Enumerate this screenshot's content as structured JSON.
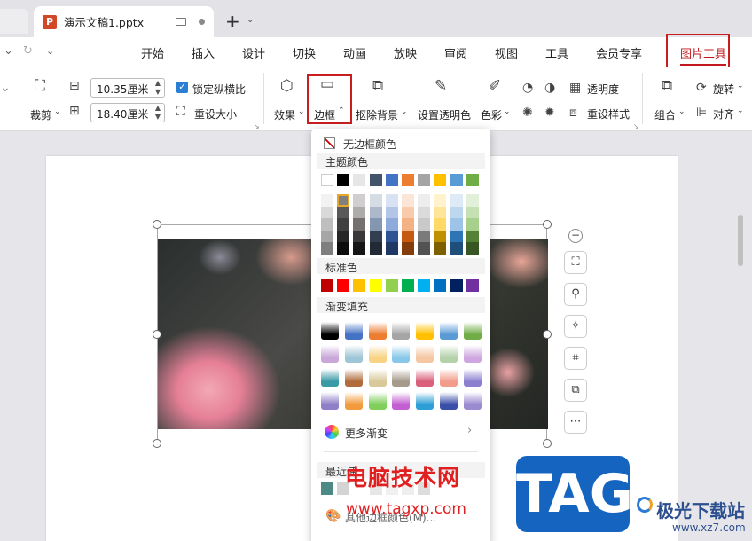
{
  "titlebar": {
    "tab_title": "演示文稿1.pptx",
    "app_icon_letter": "P",
    "new_tab": "+",
    "new_tab_caret": "⌄"
  },
  "menubar": {
    "items": [
      "开始",
      "插入",
      "设计",
      "切换",
      "动画",
      "放映",
      "审阅",
      "视图",
      "工具",
      "会员专享"
    ],
    "active": "图片工具"
  },
  "ribbon": {
    "crop": "裁剪",
    "width": "10.35厘米",
    "height": "18.40厘米",
    "lock_ratio": "锁定纵横比",
    "reset_size": "重设大小",
    "effects": "效果",
    "border": "边框",
    "remove_bg": "抠除背景",
    "set_transparent": "设置透明色",
    "color": "色彩",
    "transparency": "透明度",
    "reset_style": "重设样式",
    "group": "组合",
    "rotate": "旋转",
    "align": "对齐"
  },
  "dropdown": {
    "no_border": "无边框颜色",
    "theme_colors": "主题颜色",
    "standard_colors": "标准色",
    "gradient_fill": "渐变填充",
    "more_gradient": "更多渐变",
    "recent": "最近使",
    "other_colors": "其他边框颜色(M)...",
    "theme_top": [
      "#ffffff",
      "#000000",
      "#e7e6e6",
      "#44546a",
      "#4472c4",
      "#ed7d31",
      "#a5a5a5",
      "#ffc000",
      "#5b9bd5",
      "#70ad47"
    ],
    "theme_shades": [
      [
        "#f2f2f2",
        "#808080",
        "#d0cece",
        "#d6dce4",
        "#d9e2f3",
        "#fbe5d6",
        "#ededed",
        "#fff2cc",
        "#deebf6",
        "#e2efd9"
      ],
      [
        "#d9d9d9",
        "#595959",
        "#aeabab",
        "#adb9ca",
        "#b4c6e7",
        "#f7cbac",
        "#dbdbdb",
        "#ffe598",
        "#bdd7ee",
        "#c5e0b3"
      ],
      [
        "#bfbfbf",
        "#404040",
        "#757070",
        "#8496b0",
        "#8eaadb",
        "#f4b183",
        "#c9c9c9",
        "#ffd966",
        "#9dc3e6",
        "#a8d08d"
      ],
      [
        "#a6a6a6",
        "#262626",
        "#3a3838",
        "#333f50",
        "#2f5496",
        "#c55a11",
        "#7b7b7b",
        "#bf9000",
        "#2e75b5",
        "#538135"
      ],
      [
        "#7f7f7f",
        "#0d0d0d",
        "#171616",
        "#222a35",
        "#1f3864",
        "#833c0b",
        "#525252",
        "#7f6000",
        "#1e4e79",
        "#375623"
      ]
    ],
    "standard": [
      "#c00000",
      "#ff0000",
      "#ffc000",
      "#ffff00",
      "#92d050",
      "#00b050",
      "#00b0f0",
      "#0070c0",
      "#002060",
      "#7030a0"
    ],
    "gradients": [
      [
        "#000000",
        "#4472c4",
        "#ed7d31",
        "#a5a5a5",
        "#ffc000",
        "#5b9bd5",
        "#70ad47"
      ],
      [
        "#c9a7d9",
        "#9ec6d6",
        "#f7d383",
        "#88c7e8",
        "#f5c7a2",
        "#b4d1a9",
        "#cfa6e0"
      ],
      [
        "#3a9aa6",
        "#b06c3c",
        "#d9c99a",
        "#a59a8b",
        "#d95f7a",
        "#f29c8c",
        "#8b7fd0"
      ],
      [
        "#8f7ec8",
        "#f29b3c",
        "#7fcf5a",
        "#c35fd2",
        "#2e9fd6",
        "#3a4fa8",
        "#9a8ad0"
      ]
    ],
    "recent_colors": [
      "#4d8a86",
      "#d4d4d4",
      "#ffffff",
      "#e6e6e6",
      "#f0f0f0",
      "#eeeeee",
      "#dddddd"
    ]
  },
  "watermark": {
    "site_name": "电脑技术网",
    "site_url": "www.tagxp.com",
    "tag": "TAG",
    "brand": "极光下载站",
    "brand_url": "www.xz7.com"
  }
}
